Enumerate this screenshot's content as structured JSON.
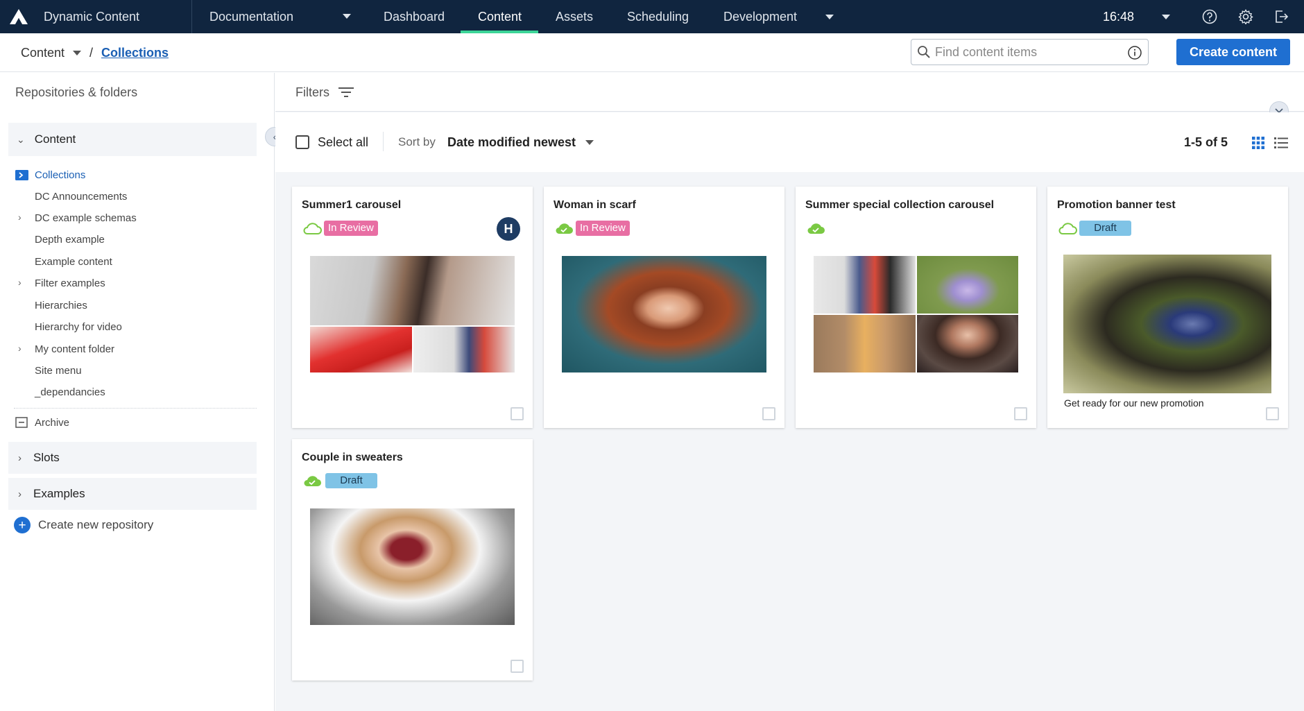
{
  "topnav": {
    "app_name": "Dynamic Content",
    "hub": "Documentation",
    "tabs": [
      "Dashboard",
      "Content",
      "Assets",
      "Scheduling",
      "Development"
    ],
    "active_tab": "Content",
    "time": "16:48"
  },
  "breadcrumb": {
    "root": "Content",
    "separator": "/",
    "current": "Collections"
  },
  "search": {
    "placeholder": "Find content items"
  },
  "create_button": "Create content",
  "sidebar": {
    "title": "Repositories & folders",
    "content_group": "Content",
    "items": [
      {
        "label": "Collections",
        "active": true,
        "expandable": false
      },
      {
        "label": "DC Announcements",
        "expandable": false
      },
      {
        "label": "DC example schemas",
        "expandable": true
      },
      {
        "label": "Depth example",
        "expandable": false
      },
      {
        "label": "Example content",
        "expandable": false
      },
      {
        "label": "Filter examples",
        "expandable": true
      },
      {
        "label": "Hierarchies",
        "expandable": false
      },
      {
        "label": "Hierarchy for video",
        "expandable": false
      },
      {
        "label": "My content folder",
        "expandable": true
      },
      {
        "label": "Site menu",
        "expandable": false
      },
      {
        "label": "_dependancies",
        "expandable": false
      }
    ],
    "archive": "Archive",
    "slots": "Slots",
    "examples": "Examples",
    "create_repo": "Create new repository"
  },
  "filters": {
    "label": "Filters"
  },
  "toolbar": {
    "select_all": "Select all",
    "sort_label": "Sort by",
    "sort_value": "Date modified newest",
    "count": "1-5 of 5"
  },
  "cards": [
    {
      "title": "Summer1 carousel",
      "status": "In Review",
      "sync": "outline",
      "avatar": "H",
      "image": "collage-3"
    },
    {
      "title": "Woman in scarf",
      "status": "In Review",
      "sync": "filled",
      "image": "woman-scarf"
    },
    {
      "title": "Summer special collection carousel",
      "status": "",
      "sync": "filled",
      "image": "collage-4"
    },
    {
      "title": "Promotion banner test",
      "status": "Draft",
      "sync": "outline",
      "image": "promo-banner",
      "caption": "Get ready for our new promotion"
    },
    {
      "title": "Couple in sweaters",
      "status": "Draft",
      "sync": "filled",
      "image": "woman-beret"
    }
  ],
  "colors": {
    "nav_bg": "#10253f",
    "accent": "#1f6fd1",
    "active_underline": "#3dd598",
    "review_badge": "#e86ea3",
    "draft_badge": "#7fc3e6",
    "sync_green": "#7ac943"
  },
  "icons": [
    "amplience-logo-icon",
    "chevron-down-icon",
    "help-icon",
    "gear-icon",
    "logout-icon",
    "search-icon",
    "info-icon",
    "folder-icon",
    "archive-icon",
    "plus-circle-icon",
    "filter-icon",
    "grid-view-icon",
    "list-view-icon",
    "cloud-sync-icon"
  ]
}
